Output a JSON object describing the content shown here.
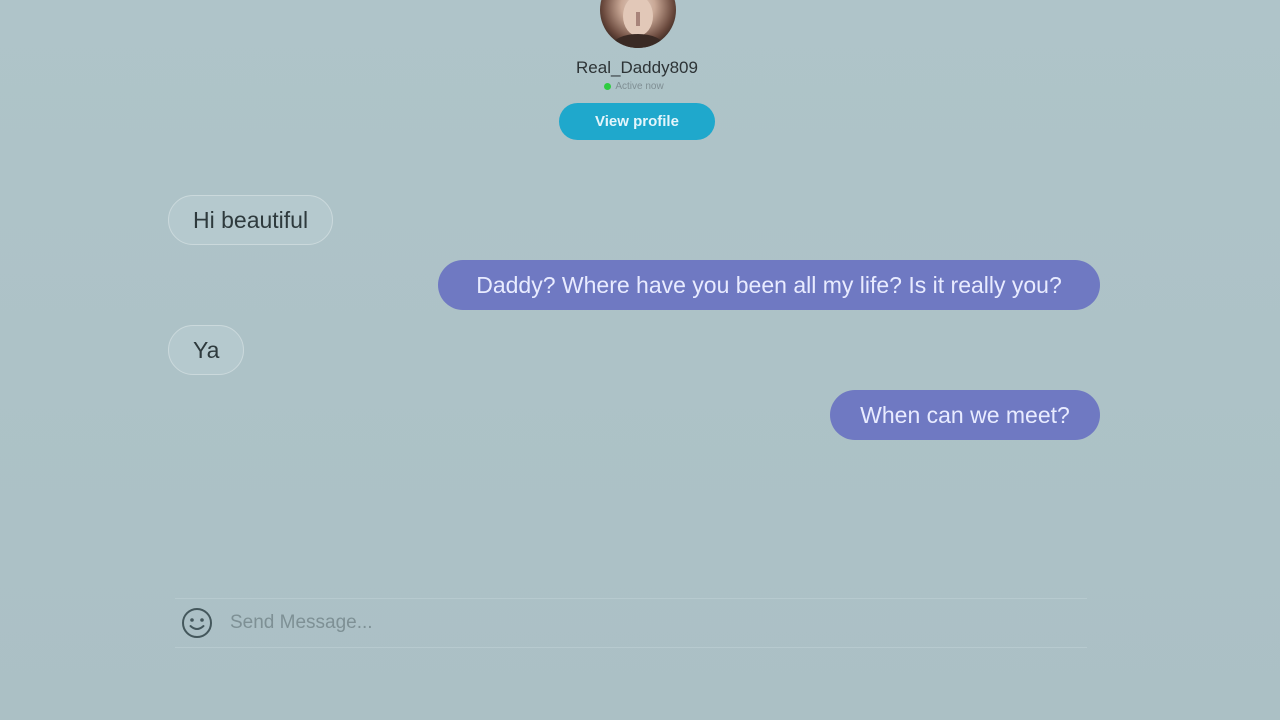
{
  "header": {
    "username": "Real_Daddy809",
    "status_text": "Active now",
    "view_profile_label": "View profile"
  },
  "messages": [
    {
      "direction": "incoming",
      "text": "Hi beautiful"
    },
    {
      "direction": "outgoing",
      "text": "Daddy? Where have you been all my life? Is it really you?"
    },
    {
      "direction": "incoming",
      "text": "Ya"
    },
    {
      "direction": "outgoing",
      "text": "When can we meet?"
    }
  ],
  "composer": {
    "placeholder": "Send Message...",
    "value": "",
    "emoji_icon": "smiley-icon"
  },
  "colors": {
    "background": "#aec3c8",
    "outgoing_bubble": "#6f79c2",
    "view_profile_button": "#1fa8cc",
    "active_dot": "#2ecc40"
  }
}
